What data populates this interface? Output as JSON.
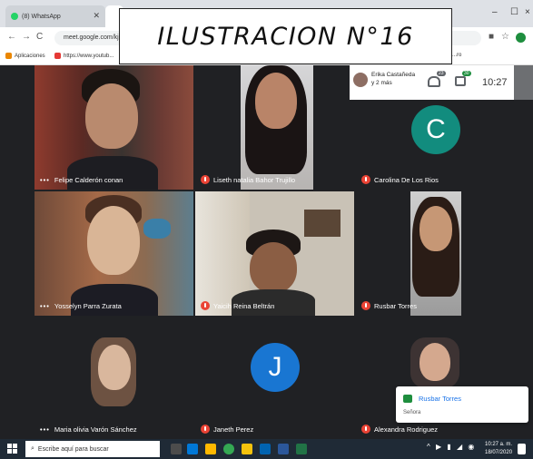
{
  "title_overlay": "ILUSTRACION N°16",
  "browser": {
    "tabs": [
      {
        "label": "(8) WhatsApp",
        "favicon": "whatsapp-icon"
      },
      {
        "label": "",
        "favicon": "meet-icon"
      }
    ],
    "window_controls": {
      "minimize": "–",
      "maximize": "☐",
      "close": "×"
    },
    "url": "meet.google.com/kjo",
    "bookmarks": [
      "Aplicaciones",
      "https://www.youtub..."
    ],
    "bookmarks_right": "...ro"
  },
  "meet": {
    "presenter": {
      "name": "Erika Castañeda",
      "sub": "y 2 más"
    },
    "participants_count": "23",
    "chat_count": "30",
    "clock": "10:27",
    "tiles": [
      {
        "name": "Felipe Calderón conan",
        "muted": false
      },
      {
        "name": "Liseth natalia Bahor Trujillo",
        "muted": true
      },
      {
        "name": "Carolina De Los Rios",
        "muted": true,
        "avatar_letter": "C"
      },
      {
        "name": "Yosselyn Parra Zurata",
        "muted": false
      },
      {
        "name": "Yaicih Reina Beltrán",
        "muted": true
      },
      {
        "name": "Rusbar Torres",
        "muted": true
      },
      {
        "name": "Maria olivia Varón Sánchez",
        "muted": false
      },
      {
        "name": "Janeth Perez",
        "muted": true,
        "avatar_letter": "J"
      },
      {
        "name": "Alexandra Rodriguez",
        "muted": true
      }
    ],
    "chat_toast": {
      "sender": "Rusbar Torres",
      "message": "Señora"
    }
  },
  "taskbar": {
    "search_placeholder": "Escribe aquí para buscar",
    "time": "10:27 a. m.",
    "date": "18/07/2020",
    "tray_icons": "^ ▶ ▮ ◢ ◉"
  },
  "colors": {
    "meet_bg": "#202124",
    "muted_red": "#ea4335",
    "avatar_c": "#128c7e",
    "avatar_j": "#1976d2",
    "taskbar": "#1f2a36"
  }
}
